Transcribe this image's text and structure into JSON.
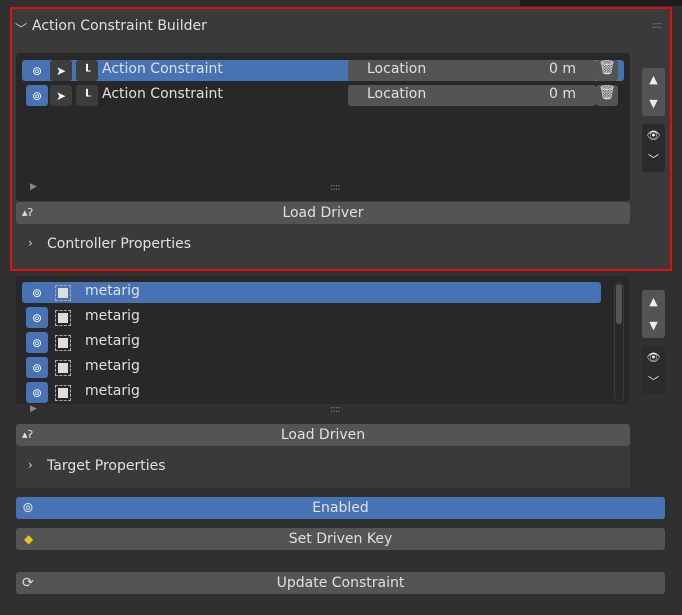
{
  "panel": {
    "title": "Action Constraint Builder",
    "constraints": [
      {
        "name": "Action Constraint",
        "type": "Location",
        "value": "0 m",
        "selected": true
      },
      {
        "name": "Action Constraint",
        "type": "Location",
        "value": "0 m",
        "selected": false
      }
    ],
    "load_driver": "Load Driver",
    "controller_properties": "Controller Properties"
  },
  "targets": {
    "items": [
      {
        "name": "metarig",
        "selected": true
      },
      {
        "name": "metarig",
        "selected": false
      },
      {
        "name": "metarig",
        "selected": false
      },
      {
        "name": "metarig",
        "selected": false
      },
      {
        "name": "metarig",
        "selected": false
      }
    ],
    "load_driven": "Load Driven",
    "target_properties": "Target Properties"
  },
  "buttons": {
    "enabled": "Enabled",
    "set_driven_key": "Set Driven Key",
    "update_constraint": "Update Constraint"
  },
  "colors": {
    "accent": "#4772b3",
    "highlight": "#e01010"
  }
}
